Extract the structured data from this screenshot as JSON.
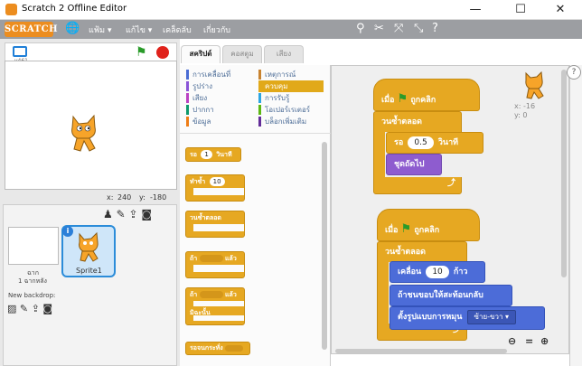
{
  "window": {
    "title": "Scratch 2 Offline Editor",
    "minimize": "—",
    "maximize": "☐",
    "close": "✕"
  },
  "menu": {
    "logo": "SCRATCH",
    "file": "แฟ้ม ▾",
    "edit": "แก้ไข ▾",
    "tips": "เคล็ดลับ",
    "about": "เกี่ยวกับ"
  },
  "stage": {
    "version": "v461",
    "x_label": "x:",
    "x_value": "240",
    "y_label": "y:",
    "y_value": "-180"
  },
  "sprites": {
    "stage_label": "ฉาก",
    "stage_sub": "1 ฉากหลัง",
    "new_backdrop": "New backdrop:",
    "sprite1": "Sprite1"
  },
  "tabs": [
    "สคริปต์",
    "คอสตูม",
    "เสียง"
  ],
  "categories_left": [
    {
      "label": "การเคลื่อนที่",
      "color": "#4a6cd4"
    },
    {
      "label": "รูปร่าง",
      "color": "#8a55d7"
    },
    {
      "label": "เสียง",
      "color": "#bb42c3"
    },
    {
      "label": "ปากกา",
      "color": "#0e9a6c"
    },
    {
      "label": "ข้อมูล",
      "color": "#ee7d16"
    }
  ],
  "categories_right": [
    {
      "label": "เหตุการณ์",
      "color": "#c88330"
    },
    {
      "label": "ควบคุม",
      "color": "#e1a91a"
    },
    {
      "label": "การรับรู้",
      "color": "#2ca5e2"
    },
    {
      "label": "โอเปอร์เรเตอร์",
      "color": "#5cb712"
    },
    {
      "label": "บล็อกเพิ่มเติม",
      "color": "#632d99"
    }
  ],
  "palette": {
    "wait": "รอ",
    "wait_val": "1",
    "wait_unit": "วินาที",
    "repeat": "ทำซ้ำ",
    "repeat_val": "10",
    "forever": "วนซ้ำตลอด",
    "if_": "ถ้า",
    "then_": "แล้ว",
    "else_": "มิฉะนั้น",
    "wait_until": "รอจนกระทั่ง"
  },
  "script1": {
    "hat": "เมื่อ",
    "hat_end": "ถูกคลิก",
    "forever": "วนซ้ำตลอด",
    "wait": "รอ",
    "wait_val": "0.5",
    "wait_unit": "วินาที",
    "next_costume": "ชุดถัดไป"
  },
  "script2": {
    "hat": "เมื่อ",
    "hat_end": "ถูกคลิก",
    "forever": "วนซ้ำตลอด",
    "move": "เคลื่อน",
    "move_val": "10",
    "move_unit": "ก้าว",
    "bounce": "ถ้าชนขอบให้สะท้อนกลับ",
    "rotation": "ตั้งรูปแบบการหมุน",
    "rotation_val": "ซ้าย-ขวา ▾"
  },
  "sprite_info": {
    "x": "x: -16",
    "y": "y: 0"
  },
  "zoom": {
    "out": "⊖",
    "reset": "=",
    "in": "⊕"
  },
  "help": "?"
}
